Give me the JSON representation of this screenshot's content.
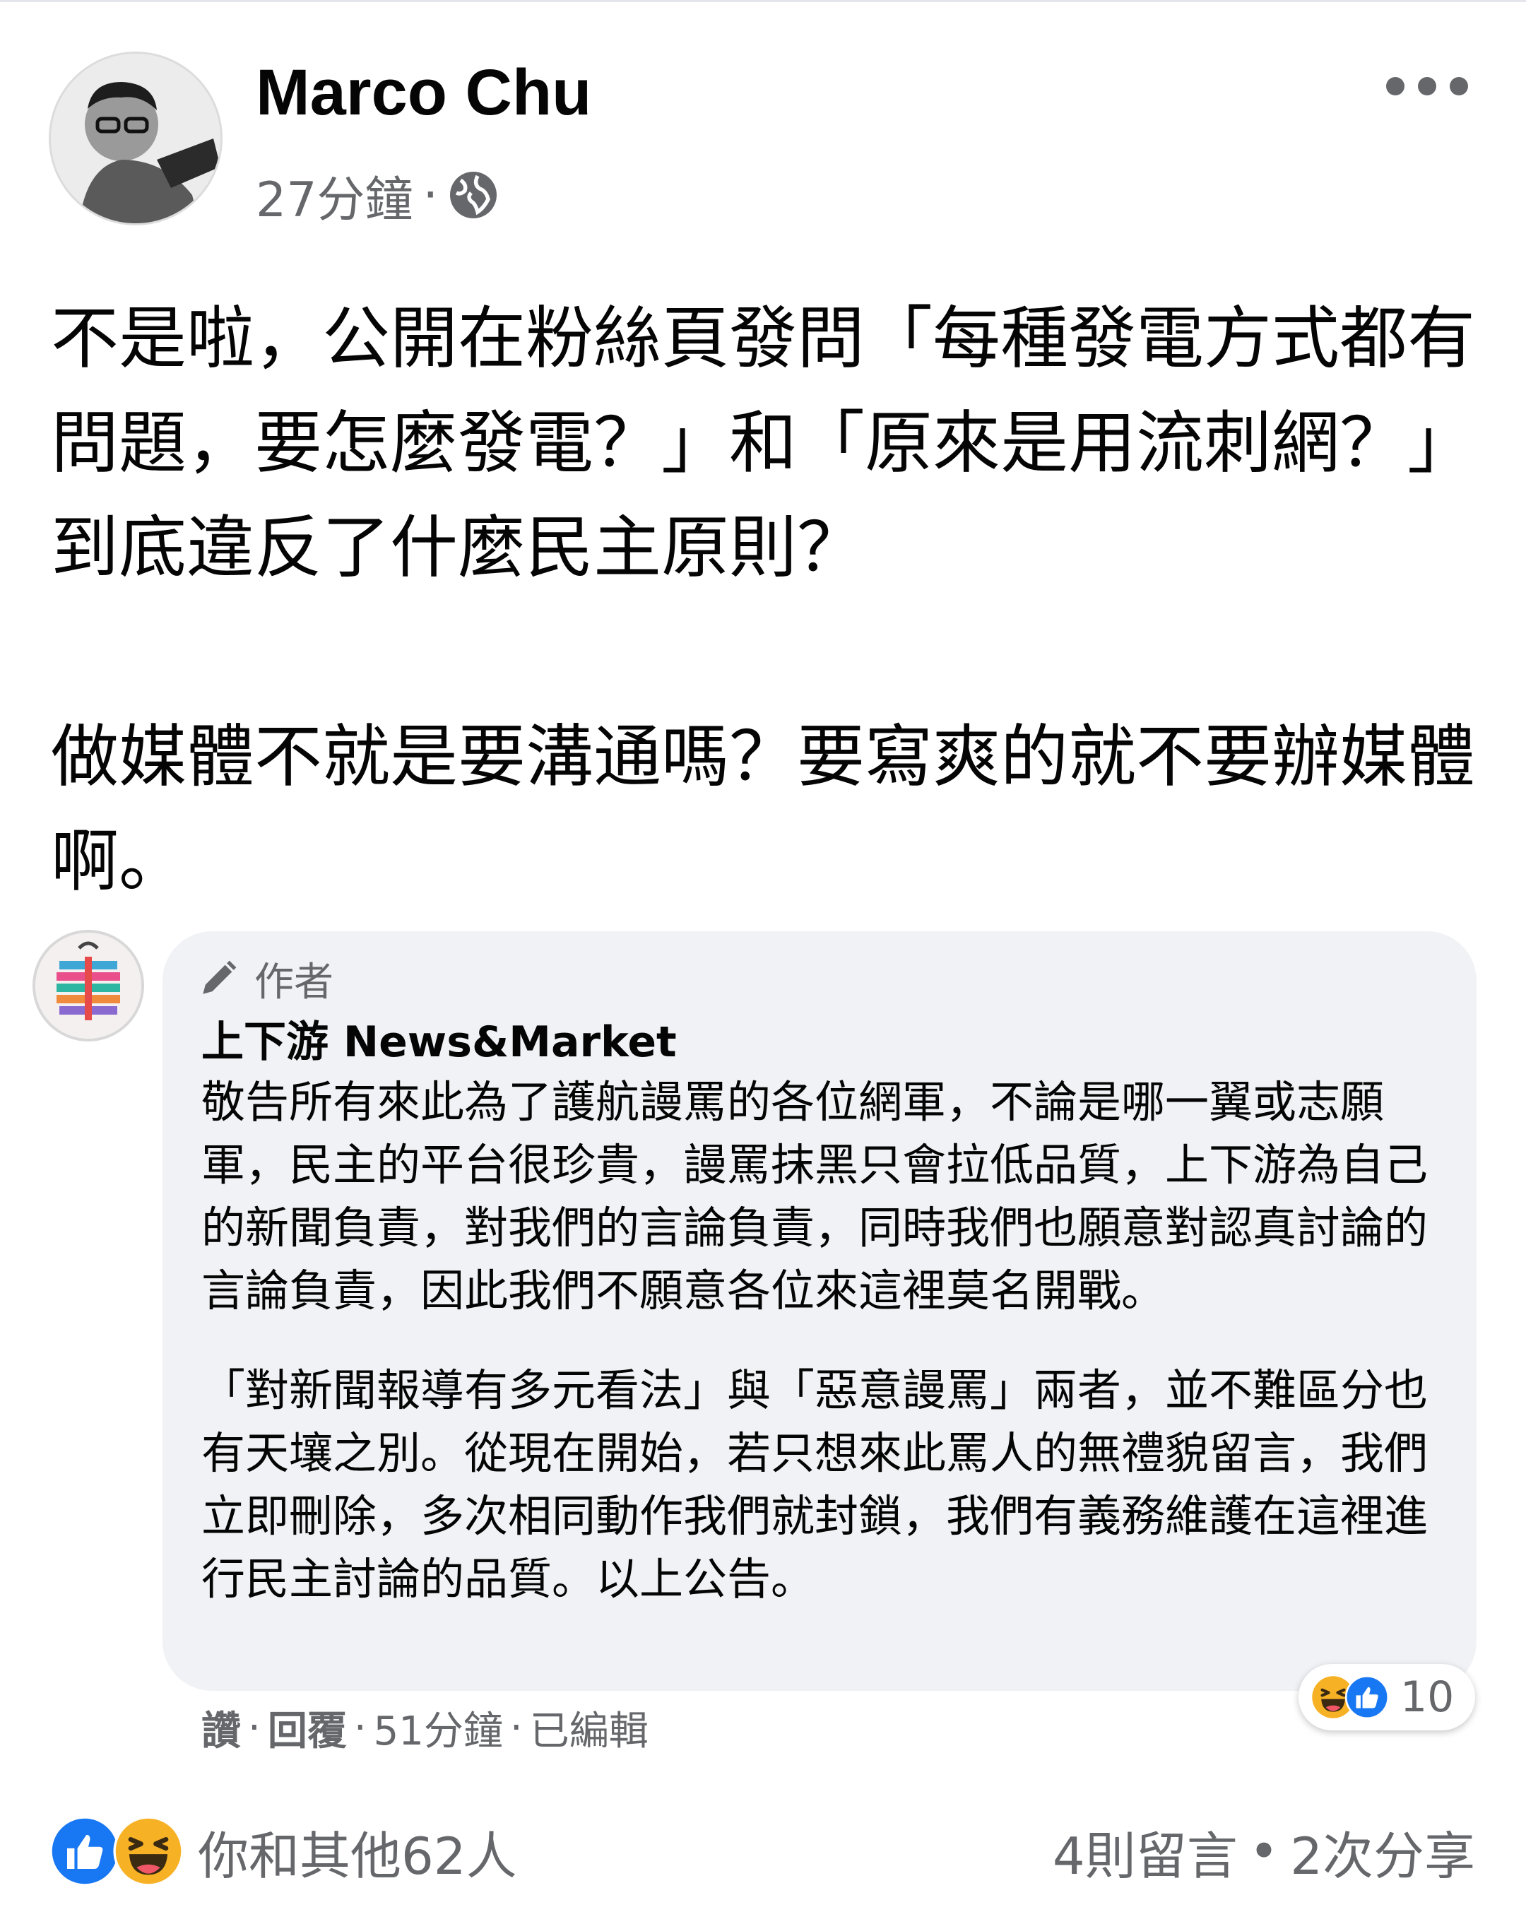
{
  "post": {
    "author": "Marco Chu",
    "time": "27分鐘",
    "separator": "·",
    "privacy_icon": "globe-icon",
    "more_icon": "more-dots-icon",
    "paragraphs": [
      "不是啦，公開在粉絲頁發問「每種發電方式都有問題，要怎麼發電？」和「原來是用流刺網？」到底違反了什麼民主原則？",
      "做媒體不就是要溝通嗎？要寫爽的就不要辦媒體啊。"
    ]
  },
  "comment": {
    "badge_icon": "pencil-icon",
    "badge": "作者",
    "author": "上下游 News&Market",
    "paragraphs": [
      "敬告所有來此為了護航謾罵的各位網軍，不論是哪一翼或志願軍，民主的平台很珍貴，謾罵抹黑只會拉低品質，上下游為自己的新聞負責，對我們的言論負責，同時我們也願意對認真討論的言論負責，因此我們不願意各位來這裡莫名開戰。",
      "「對新聞報導有多元看法」與「惡意謾罵」兩者，並不難區分也有天壤之別。從現在開始，若只想來此罵人的無禮貌留言，我們立即刪除，多次相同動作我們就封鎖，我們有義務維護在這裡進行民主討論的品質。以上公告。"
    ],
    "reaction_icons": [
      "haha-icon",
      "like-icon"
    ],
    "reaction_count": "10",
    "actions": {
      "like": "讚",
      "reply": "回覆",
      "time": "51分鐘",
      "edited": "已編輯",
      "separator": "·"
    }
  },
  "footer": {
    "reaction_icons": [
      "like-icon",
      "haha-icon"
    ],
    "reactions_text": "你和其他62人",
    "comments": "4則留言",
    "separator": "•",
    "shares": "2次分享"
  },
  "colors": {
    "text": "#050505",
    "secondary": "#65676b",
    "bubble": "#f0f2f5",
    "like_blue": "#1877f2",
    "haha_yellow": "#f7b125"
  }
}
